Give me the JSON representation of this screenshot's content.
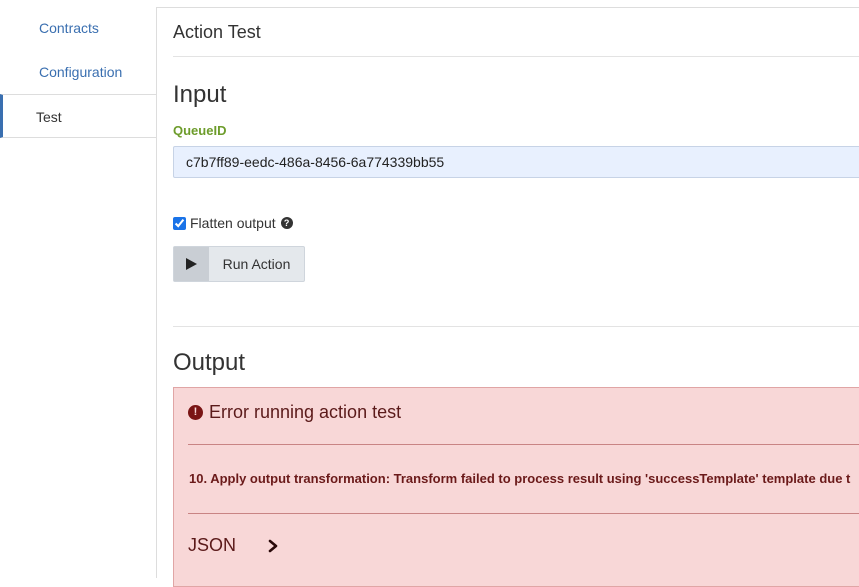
{
  "sidebar": {
    "items": [
      {
        "label": "Contracts",
        "active": false
      },
      {
        "label": "Configuration",
        "active": false
      },
      {
        "label": "Test",
        "active": true
      }
    ]
  },
  "panel": {
    "title": "Action Test"
  },
  "input_section": {
    "heading": "Input",
    "queue_label": "QueueID",
    "queue_value": "c7b7ff89-eedc-486a-8456-6a774339bb55",
    "flatten_label": "Flatten output",
    "flatten_checked": true,
    "run_label": "Run Action"
  },
  "output_section": {
    "heading": "Output",
    "error_title": "Error running action test",
    "error_message": "10. Apply output transformation: Transform failed to process result using 'successTemplate' template due t",
    "json_label": "JSON"
  },
  "icons": {
    "help": "question-circle-icon",
    "play": "play-icon",
    "error": "exclamation-circle-icon",
    "chevron": "chevron-right-icon"
  },
  "colors": {
    "link": "#3a6fb0",
    "label_green": "#6d9c2b",
    "error_bg": "#f8d7d7",
    "error_text": "#5b1a1a",
    "input_bg": "#e8f0fe"
  }
}
